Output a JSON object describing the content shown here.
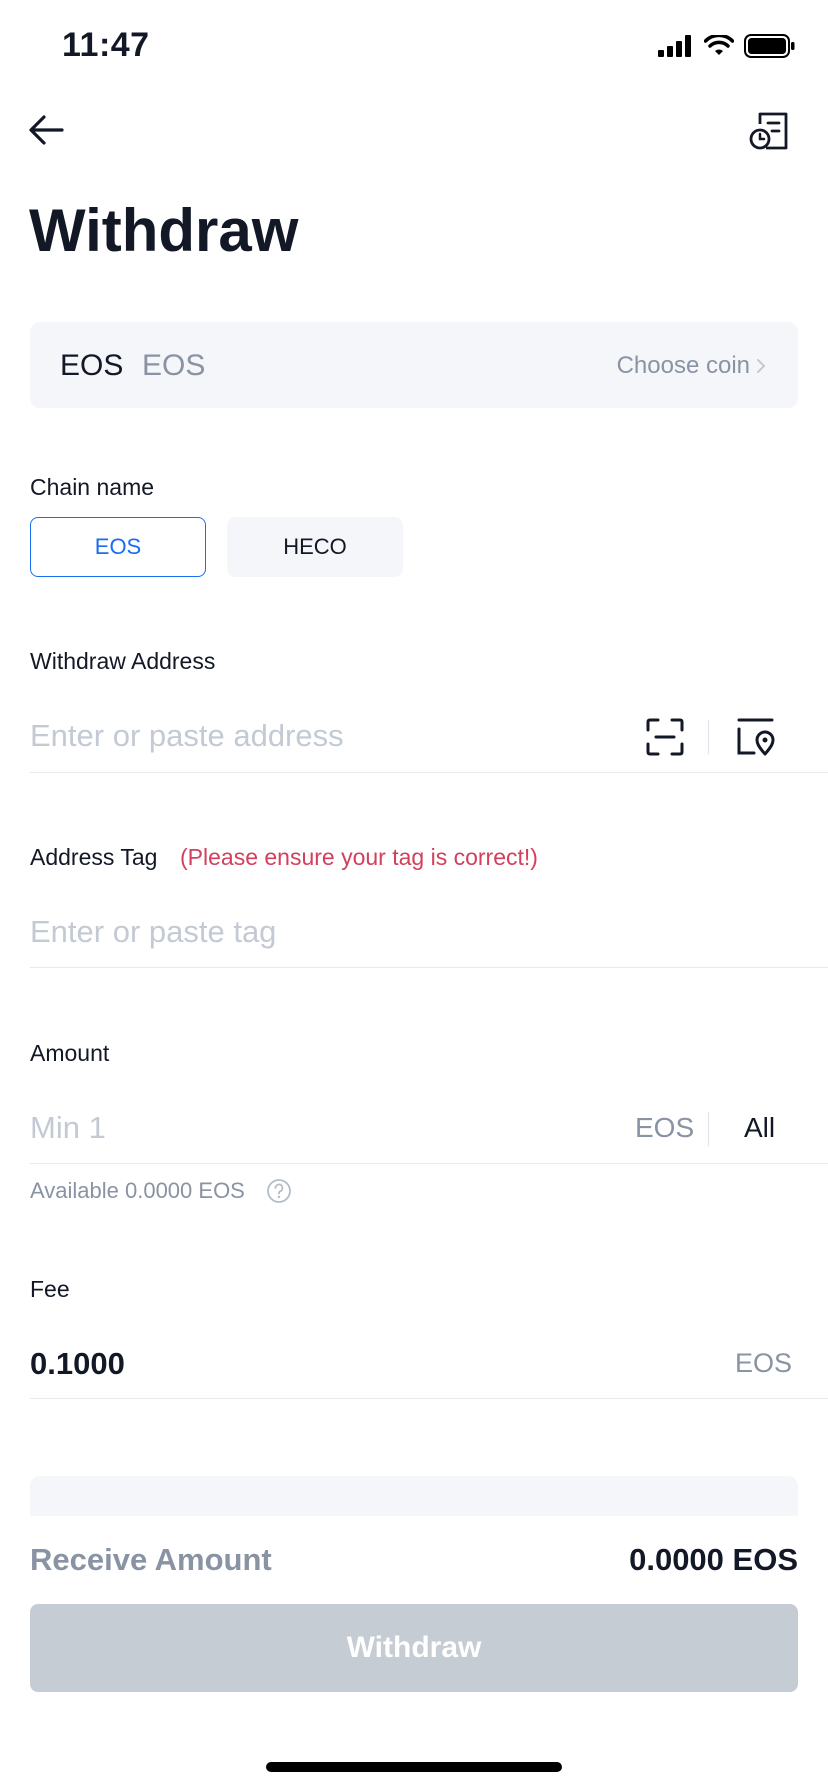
{
  "status_bar": {
    "time": "11:47"
  },
  "header": {
    "title": "Withdraw"
  },
  "coin": {
    "code": "EOS",
    "name": "EOS",
    "choose_label": "Choose coin"
  },
  "chain": {
    "label": "Chain name",
    "options": [
      "EOS",
      "HECO"
    ],
    "selected": "EOS"
  },
  "address": {
    "label": "Withdraw Address",
    "placeholder": "Enter or paste address"
  },
  "tag": {
    "label": "Address Tag",
    "warning": "(Please ensure your tag is correct!)",
    "placeholder": "Enter or paste tag"
  },
  "amount": {
    "label": "Amount",
    "placeholder": "Min 1",
    "unit": "EOS",
    "all_label": "All",
    "available": "Available 0.0000 EOS"
  },
  "fee": {
    "label": "Fee",
    "value": "0.1000",
    "unit": "EOS"
  },
  "receive": {
    "label": "Receive Amount",
    "value": "0.0000 EOS"
  },
  "submit": {
    "label": "Withdraw"
  },
  "colors": {
    "accent": "#1a6df2",
    "warning": "#d33f5c",
    "button_disabled": "#c5ccd4"
  }
}
